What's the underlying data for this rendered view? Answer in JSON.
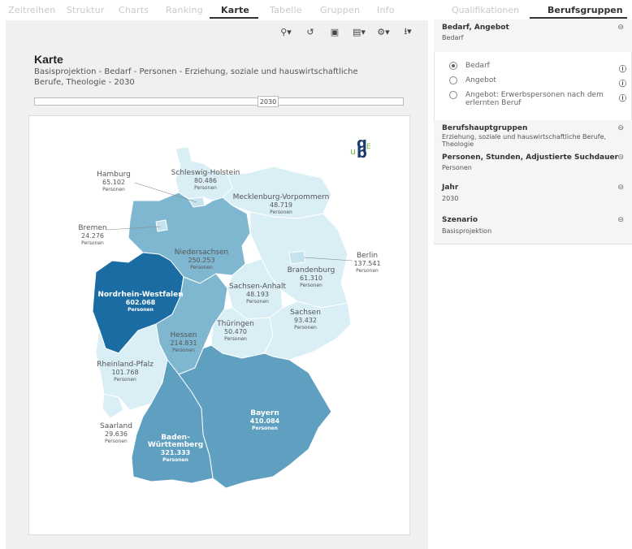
{
  "tabs": [
    "Zeitreihen",
    "Struktur",
    "Charts",
    "Ranking",
    "Karte",
    "Tabelle",
    "Gruppen",
    "Info"
  ],
  "active_tab": "Karte",
  "toolbar": {
    "icons": [
      "pin-icon",
      "undo-icon",
      "save-icon",
      "layout-icon",
      "settings-icon",
      "download-icon"
    ],
    "glyphs": [
      "⚲▾",
      "↺",
      "▣",
      "▤▾",
      "⚙▾",
      "⭳▾"
    ]
  },
  "card": {
    "title": "Karte",
    "subtitle": "Basisprojektion - Bedarf - Personen - Erziehung, soziale und hauswirtschaftliche Berufe, Theologie - 2030",
    "slider_value": "2030"
  },
  "logo": {
    "q": "q",
    "u": "u",
    "b": "b",
    "e": "E"
  },
  "map": {
    "colors": {
      "light": "#d9eef5",
      "light2": "#c4e3ee",
      "mid": "#7fb7d0",
      "mid2": "#5f9fc0",
      "dark": "#1a6ca3"
    },
    "unit": "Personen",
    "states": [
      {
        "name": "Schleswig-Holstein",
        "value": "80.486"
      },
      {
        "name": "Hamburg",
        "value": "65.102"
      },
      {
        "name": "Mecklenburg-Vorpommern",
        "value": "48.719"
      },
      {
        "name": "Bremen",
        "value": "24.276"
      },
      {
        "name": "Niedersachsen",
        "value": "250.253"
      },
      {
        "name": "Berlin",
        "value": "137.541"
      },
      {
        "name": "Brandenburg",
        "value": "61.310"
      },
      {
        "name": "Sachsen-Anhalt",
        "value": "48.193"
      },
      {
        "name": "Nordrhein-Westfalen",
        "value": "602.068"
      },
      {
        "name": "Sachsen",
        "value": "93.432"
      },
      {
        "name": "Thüringen",
        "value": "50.470"
      },
      {
        "name": "Hessen",
        "value": "214.831"
      },
      {
        "name": "Rheinland-Pfalz",
        "value": "101.768"
      },
      {
        "name": "Bayern",
        "value": "410.084"
      },
      {
        "name": "Saarland",
        "value": "29.636"
      },
      {
        "name": "Baden-Württemberg",
        "value": "321.333"
      }
    ]
  },
  "right": {
    "tabs": [
      "Qualifikationen",
      "Berufsgruppen"
    ],
    "active_tab": "Berufsgruppen",
    "sections": [
      {
        "title": "Bedarf, Angebot",
        "value": "Bedarf"
      },
      {
        "title": "Berufshauptgruppen",
        "value": "Erziehung, soziale und hauswirtschaftliche Berufe, Theologie"
      },
      {
        "title": "Personen, Stunden, Adjustierte Suchdauer",
        "value": "Personen"
      },
      {
        "title": "Jahr",
        "value": "2030"
      },
      {
        "title": "Szenario",
        "value": "Basisprojektion"
      }
    ],
    "options": [
      {
        "label": "Bedarf",
        "selected": true
      },
      {
        "label": "Angebot",
        "selected": false
      },
      {
        "label": "Angebot: Erwerbspersonen nach dem erlernten Beruf",
        "selected": false
      }
    ],
    "collapse_glyph": "⊖",
    "info_glyph": "ⓘ"
  }
}
